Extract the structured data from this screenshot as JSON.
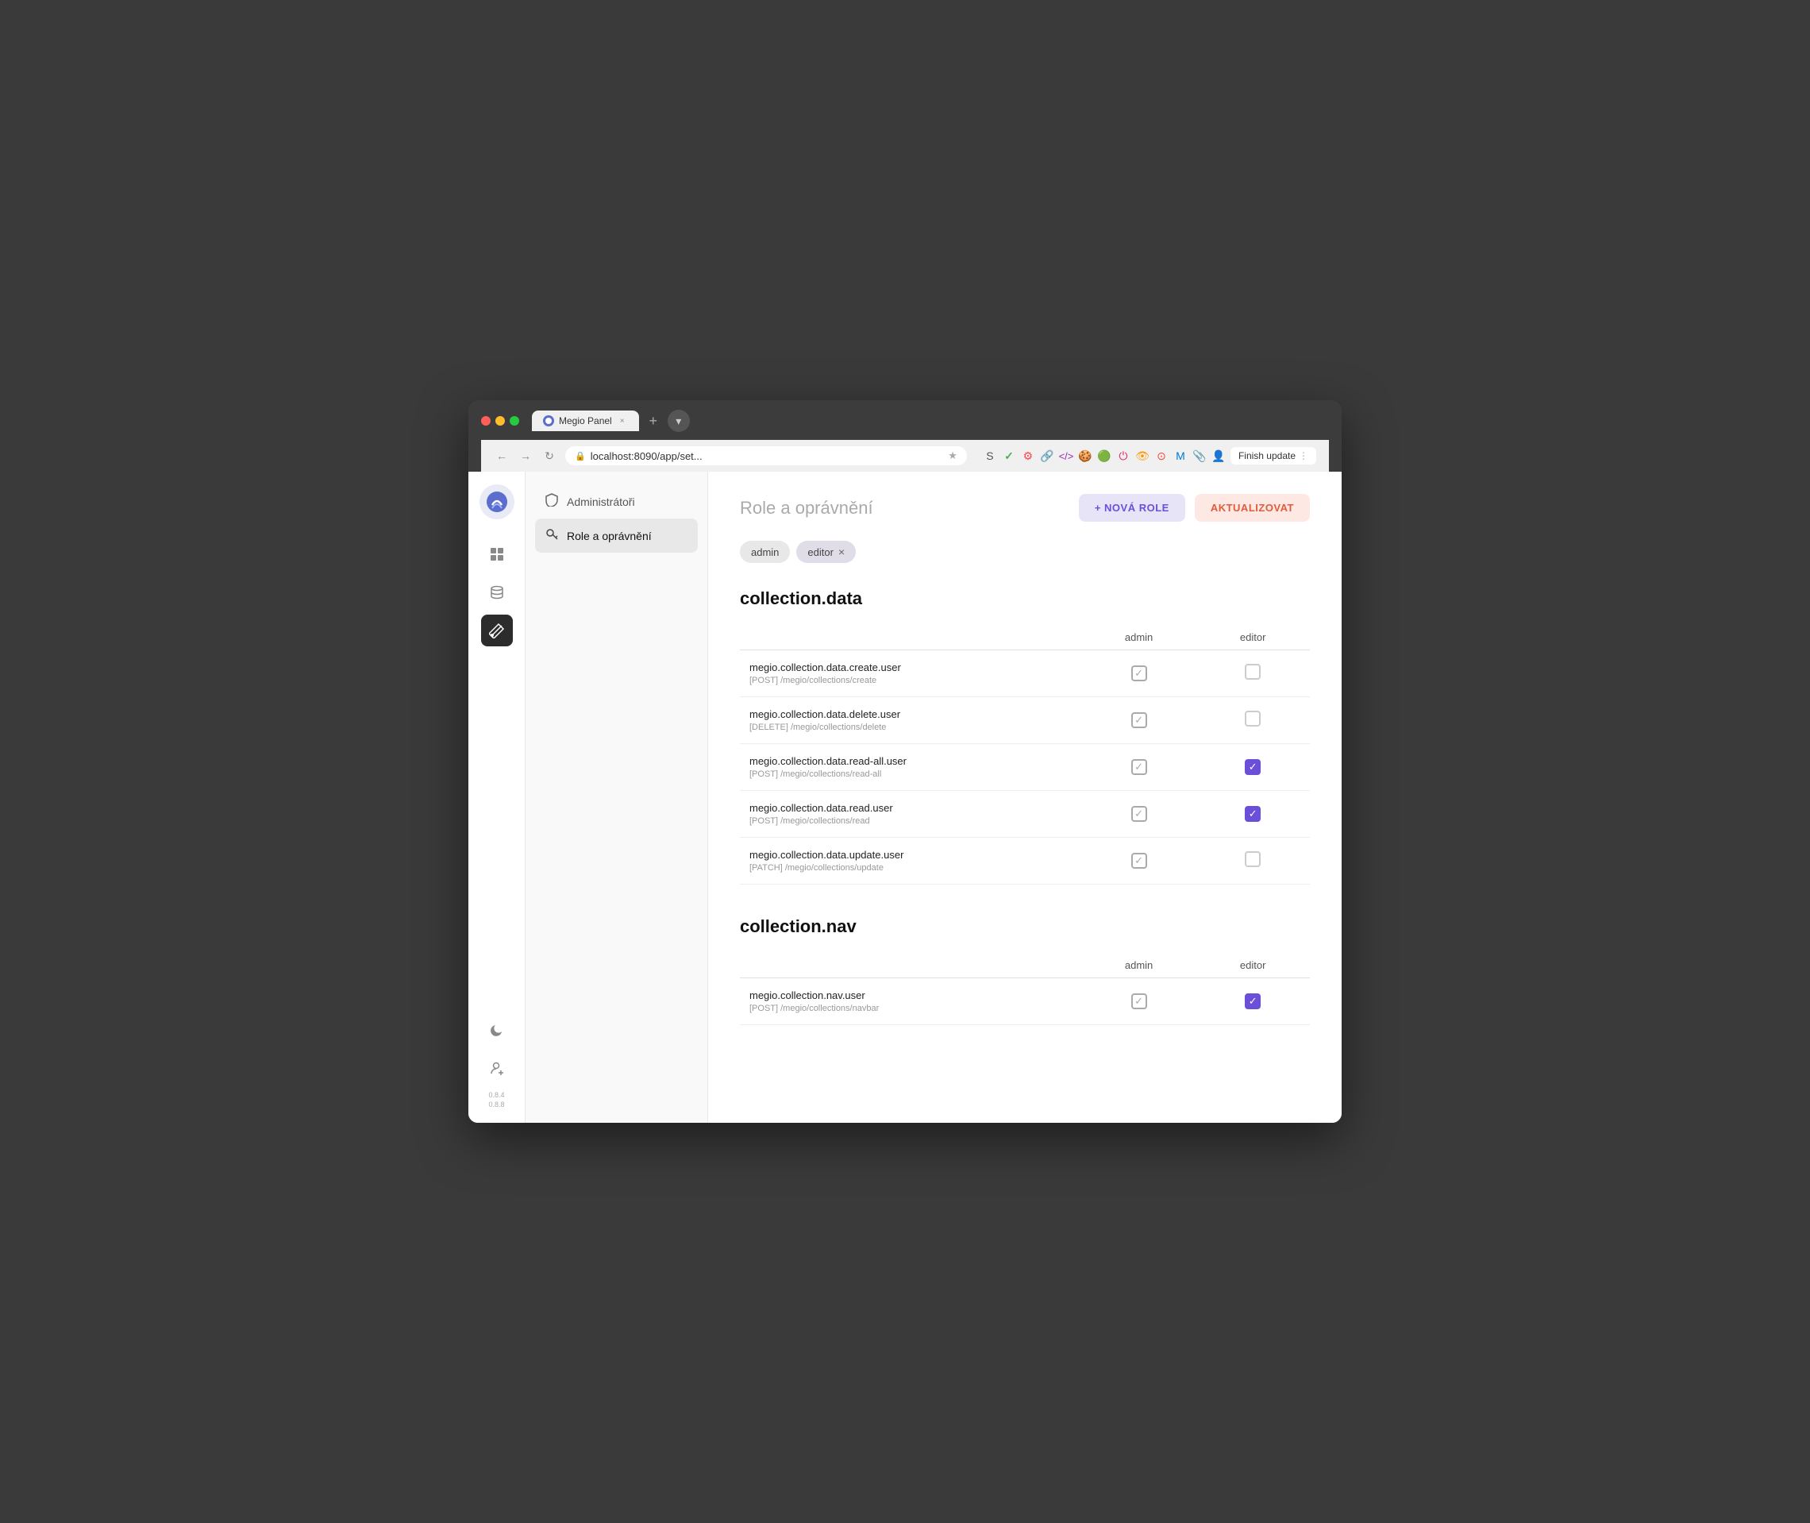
{
  "browser": {
    "tab_title": "Megio Panel",
    "address": "localhost:8090/app/set...",
    "finish_update_label": "Finish update",
    "tab_close": "×",
    "tab_add": "+"
  },
  "sidebar_icons": {
    "logo_alt": "Megio logo",
    "icons": [
      {
        "name": "dashboard-icon",
        "symbol": "⊞",
        "active": false
      },
      {
        "name": "database-icon",
        "symbol": "🗄",
        "active": false
      },
      {
        "name": "tools-icon",
        "symbol": "⚙",
        "active": true
      }
    ],
    "bottom_icons": [
      {
        "name": "moon-icon",
        "symbol": "🌙"
      },
      {
        "name": "user-plus-icon",
        "symbol": "👤+"
      }
    ],
    "version_line1": "0.8.4",
    "version_line2": "0.8.8"
  },
  "nav_sidebar": {
    "items": [
      {
        "label": "Administrátoři",
        "icon": "shield",
        "active": false
      },
      {
        "label": "Role a oprávnění",
        "icon": "key",
        "active": true
      }
    ]
  },
  "main": {
    "page_title": "Role a oprávnění",
    "btn_nova_role": "+ NOVÁ ROLE",
    "btn_aktualizovat": "AKTUALIZOVAT",
    "role_tags": [
      {
        "label": "admin",
        "closeable": false
      },
      {
        "label": "editor",
        "closeable": true
      }
    ],
    "permission_groups": [
      {
        "title": "collection.data",
        "columns": [
          "admin",
          "editor"
        ],
        "permissions": [
          {
            "name": "megio.collection.data.create.user",
            "path": "[POST] /megio/collections/create",
            "admin": "checked-gray",
            "editor": "unchecked"
          },
          {
            "name": "megio.collection.data.delete.user",
            "path": "[DELETE] /megio/collections/delete",
            "admin": "checked-gray",
            "editor": "unchecked"
          },
          {
            "name": "megio.collection.data.read-all.user",
            "path": "[POST] /megio/collections/read-all",
            "admin": "checked-gray",
            "editor": "checked-purple"
          },
          {
            "name": "megio.collection.data.read.user",
            "path": "[POST] /megio/collections/read",
            "admin": "checked-gray",
            "editor": "checked-purple"
          },
          {
            "name": "megio.collection.data.update.user",
            "path": "[PATCH] /megio/collections/update",
            "admin": "checked-gray",
            "editor": "unchecked"
          }
        ]
      },
      {
        "title": "collection.nav",
        "columns": [
          "admin",
          "editor"
        ],
        "permissions": [
          {
            "name": "megio.collection.nav.user",
            "path": "[POST] /megio/collections/navbar",
            "admin": "checked-gray",
            "editor": "checked-purple"
          }
        ]
      }
    ]
  }
}
